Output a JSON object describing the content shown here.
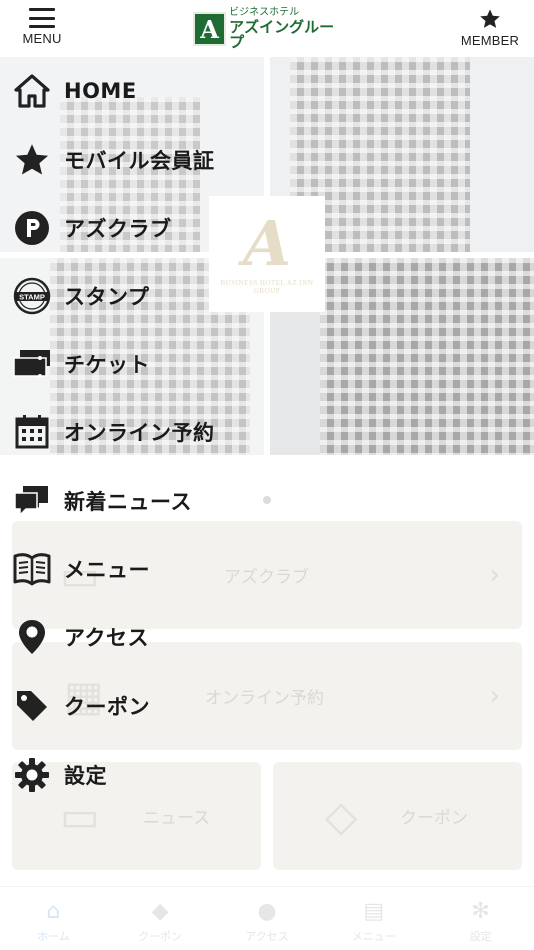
{
  "header": {
    "menu_label": "MENU",
    "member_label": "MEMBER",
    "logo_letter": "A",
    "logo_sub": "ビジネスホテル",
    "logo_main": "アズイングループ"
  },
  "hero": {
    "logo_letter": "A",
    "logo_caption": "BUSINESS HOTEL AZ INN GROUP"
  },
  "cards": [
    {
      "label": "アズクラブ"
    },
    {
      "label": "オンライン予約"
    },
    {
      "label": "ニュース"
    },
    {
      "label": "クーポン"
    }
  ],
  "menu": {
    "items": [
      {
        "label": "HOME",
        "icon": "home-icon"
      },
      {
        "label": "モバイル会員証",
        "icon": "star-icon"
      },
      {
        "label": "アズクラブ",
        "icon": "p-circle-icon"
      },
      {
        "label": "スタンプ",
        "icon": "stamp-icon"
      },
      {
        "label": "チケット",
        "icon": "ticket-icon"
      },
      {
        "label": "オンライン予約",
        "icon": "calendar-icon"
      },
      {
        "label": "新着ニュース",
        "icon": "chat-bubbles-icon"
      },
      {
        "label": "メニュー",
        "icon": "book-icon"
      },
      {
        "label": "アクセス",
        "icon": "map-pin-icon"
      },
      {
        "label": "クーポン",
        "icon": "tag-icon"
      },
      {
        "label": "設定",
        "icon": "gear-icon"
      }
    ]
  },
  "tabbar": {
    "items": [
      {
        "label": "ホーム",
        "icon": "home-icon",
        "active": true
      },
      {
        "label": "クーポン",
        "icon": "tag-icon"
      },
      {
        "label": "アクセス",
        "icon": "map-pin-icon"
      },
      {
        "label": "メニュー",
        "icon": "book-icon"
      },
      {
        "label": "設定",
        "icon": "gear-icon"
      }
    ]
  },
  "colors": {
    "brand_green": "#1f6b34",
    "menu_text": "#1a1a1a",
    "card_bg": "#f4f2ee",
    "tab_active": "#d6e6f4"
  }
}
